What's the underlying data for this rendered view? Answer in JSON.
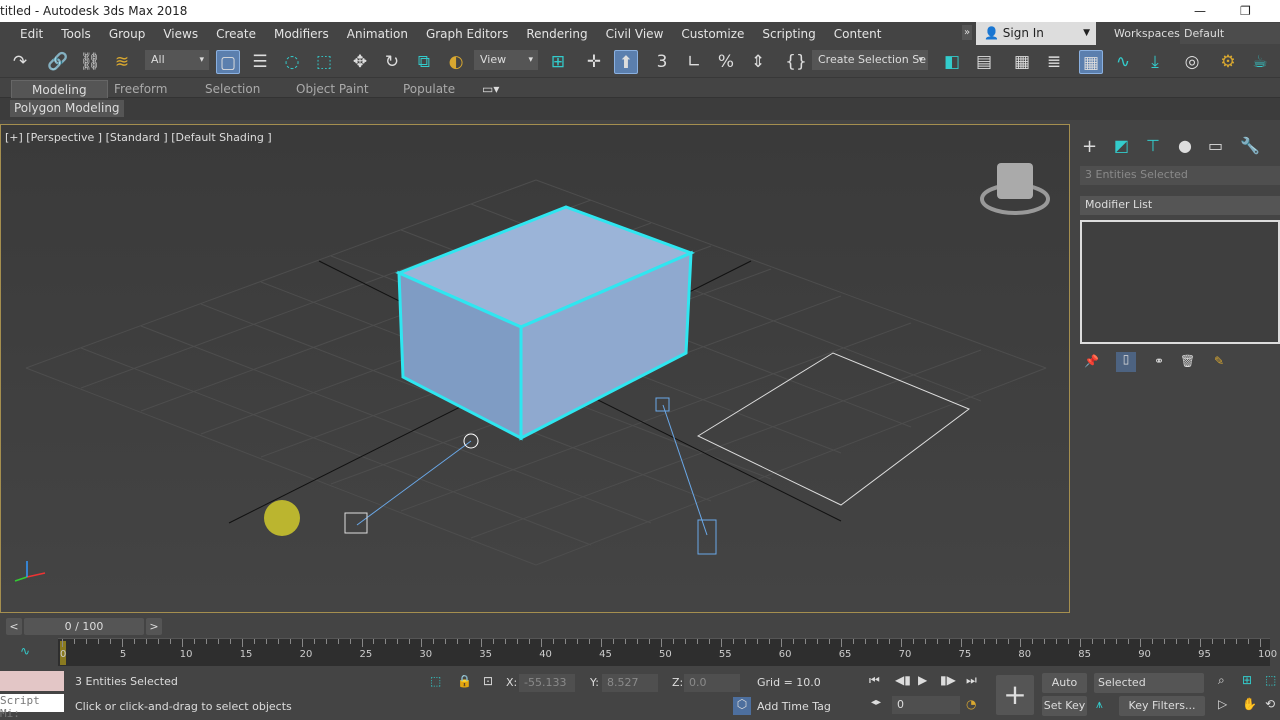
{
  "window": {
    "title": "titled - Autodesk 3ds Max 2018",
    "minimize": "—",
    "restore": "❐"
  },
  "menu": [
    "Edit",
    "Tools",
    "Group",
    "Views",
    "Create",
    "Modifiers",
    "Animation",
    "Graph Editors",
    "Rendering",
    "Civil View",
    "Customize",
    "Scripting",
    "Content"
  ],
  "account": {
    "sign_in": "Sign In",
    "workspaces_label": "Workspaces:",
    "workspace": "Default",
    "overflow": "»"
  },
  "toolbar": {
    "selection_filter": "All",
    "ref_coord": "View",
    "named_selection": "Create Selection Se"
  },
  "ribbon": {
    "tabs": [
      "Modeling",
      "Freeform",
      "Selection",
      "Object Paint",
      "Populate"
    ],
    "active": "Modeling",
    "panel": "Polygon Modeling"
  },
  "viewport": {
    "label": "[+] [Perspective ] [Standard ] [Default Shading ]"
  },
  "command_panel": {
    "selection": "3 Entities Selected",
    "modifier_list": "Modifier List"
  },
  "time": {
    "slider": "0 / 100",
    "prev": "<",
    "next": ">",
    "ticks": [
      "0",
      "5",
      "10",
      "15",
      "20",
      "25",
      "30",
      "35",
      "40",
      "45",
      "50",
      "55",
      "60",
      "65",
      "70",
      "75",
      "80",
      "85",
      "90",
      "95",
      "100"
    ]
  },
  "status": {
    "selected": "3 Entities Selected",
    "prompt": "Click or click-and-drag to select objects",
    "script": "Script Mi:",
    "x_label": "X:",
    "x": "-55.133",
    "y_label": "Y:",
    "y": "8.527",
    "z_label": "Z:",
    "z": "0.0",
    "grid": "Grid = 10.0",
    "add_time_tag": "Add Time Tag",
    "frame": "0",
    "auto_key": "Auto Key",
    "set_key": "Set Key",
    "key_mode": "Selected",
    "key_filters": "Key Filters..."
  },
  "colors": {
    "accent": "#5b7fae",
    "viewport_border": "#a58f4f",
    "selection": "#2fe6f0",
    "box": "#8fa9cf"
  }
}
